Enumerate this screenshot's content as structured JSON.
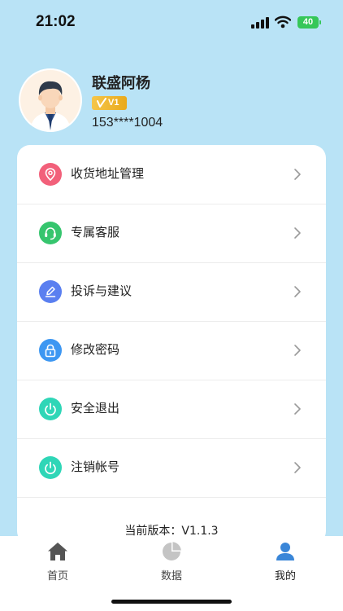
{
  "status_bar": {
    "time": "21:02",
    "battery": "40"
  },
  "profile": {
    "name": "联盛阿杨",
    "vip_level": "V1",
    "phone": "153****1004"
  },
  "menu": [
    {
      "label": "收货地址管理",
      "icon": "location-pin-icon",
      "color": "#f2607a"
    },
    {
      "label": "专属客服",
      "icon": "headset-icon",
      "color": "#36c56e"
    },
    {
      "label": "投诉与建议",
      "icon": "pen-icon",
      "color": "#5a7ff0"
    },
    {
      "label": "修改密码",
      "icon": "lock-icon",
      "color": "#3d97f2"
    },
    {
      "label": "安全退出",
      "icon": "power-icon",
      "color": "#2fd6b7"
    },
    {
      "label": "注销帐号",
      "icon": "power-icon",
      "color": "#2fd6b7"
    }
  ],
  "version": {
    "text": "当前版本：V1.1.3"
  },
  "tabs": [
    {
      "label": "首页",
      "icon": "home-icon"
    },
    {
      "label": "数据",
      "icon": "pie-chart-icon"
    },
    {
      "label": "我的",
      "icon": "user-icon",
      "active": true
    }
  ],
  "colors": {
    "background": "#b9e3f6",
    "vip_gold": "#f0b72e",
    "active_tab": "#3a86d8",
    "inactive_tab": "#bfbfbf",
    "home_tab": "#555555"
  }
}
